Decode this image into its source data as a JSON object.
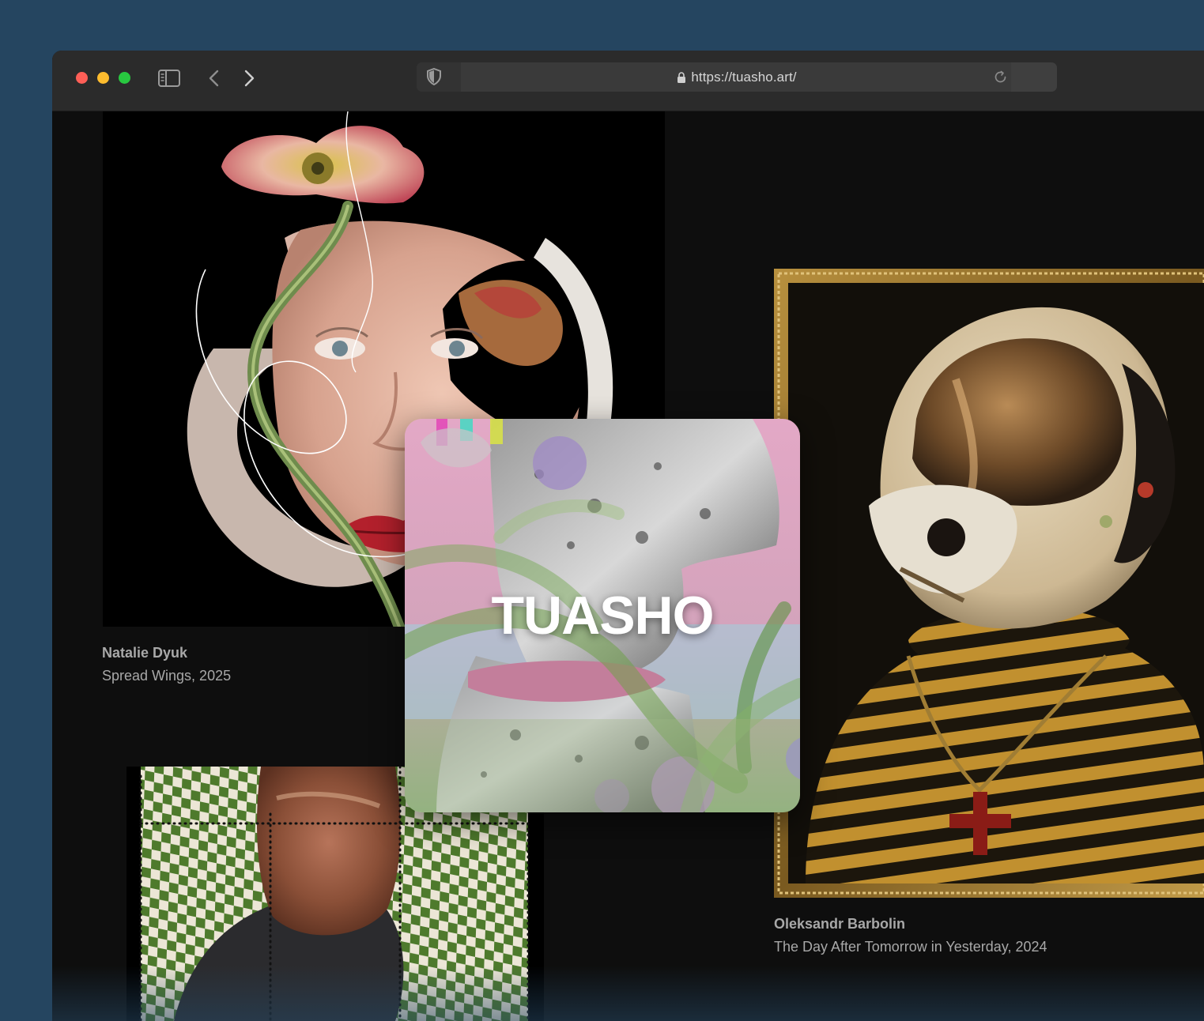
{
  "browser": {
    "url": "https://tuasho.art/"
  },
  "site": {
    "logo_text": "TUASHO"
  },
  "artworks": [
    {
      "artist": "Natalie Dyuk",
      "title": "Spread Wings, 2025"
    },
    {
      "artist": "Oleksandr Barbolin",
      "title": "The Day After Tomorrow in Yesterday, 2024"
    },
    {
      "artist": "",
      "title": ""
    }
  ],
  "icons": {
    "window_controls": [
      "close-button",
      "minimize-button",
      "zoom-button"
    ],
    "toolbar": [
      "sidebar-icon",
      "chevron-left-icon",
      "chevron-right-icon",
      "shield-icon",
      "lock-icon",
      "reload-icon"
    ]
  },
  "colors": {
    "page_background": "#254560",
    "browser_content": "#0e0e0e",
    "toolbar": "#2b2b2b",
    "caption_text": "#a8a8a8"
  }
}
